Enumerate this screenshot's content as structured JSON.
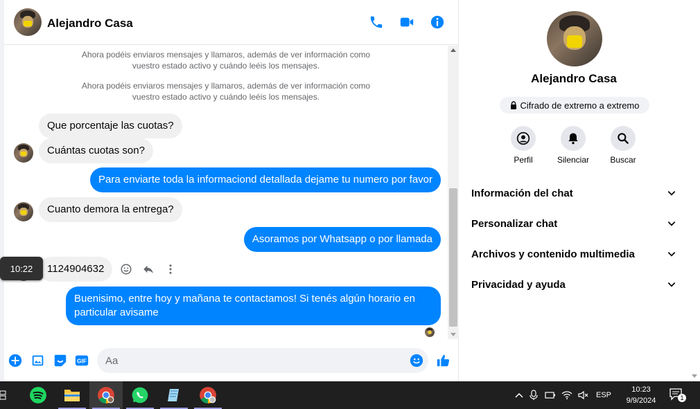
{
  "contact": {
    "name": "Alejandro Casa"
  },
  "header": {
    "actions": [
      "phone-icon",
      "video-icon",
      "info-icon"
    ]
  },
  "messages": {
    "system_notes": [
      "Ahora podéis enviaros mensajes y llamaros, además de ver información como vuestro estado activo y cuándo leéis los mensajes.",
      "Ahora podéis enviaros mensajes y llamaros, además de ver información como vuestro estado activo y cuándo leéis los mensajes."
    ],
    "items": [
      {
        "dir": "in",
        "text": "Que porcentaje las cuotas?"
      },
      {
        "dir": "in",
        "text": "Cuántas cuotas son?"
      },
      {
        "dir": "out",
        "text": "Para enviarte toda la informaciond detallada dejame tu numero por favor"
      },
      {
        "dir": "in",
        "text": "Cuanto demora la entrega?"
      },
      {
        "dir": "out",
        "text": "Asoramos por Whatsapp o por llamada"
      },
      {
        "dir": "in",
        "text": "1124904632"
      },
      {
        "dir": "out",
        "text": "Buenisimo, entre hoy y mañana te contactamos! Si tenés algún horario en particular avisame"
      }
    ],
    "tooltip_time": "10:22"
  },
  "composer": {
    "placeholder": "Aa"
  },
  "panel": {
    "encryption": "Cifrado de extremo a extremo",
    "buttons": [
      "Perfil",
      "Silenciar",
      "Buscar"
    ],
    "sections": [
      "Información del chat",
      "Personalizar chat",
      "Archivos y contenido multimedia",
      "Privacidad y ayuda"
    ]
  },
  "taskbar": {
    "language": "ESP",
    "time": "10:23",
    "date": "9/9/2024",
    "notification_count": "1"
  },
  "colors": {
    "accent": "#0084ff",
    "incoming": "#f0f0f0",
    "taskbar": "#1f1f1f"
  }
}
